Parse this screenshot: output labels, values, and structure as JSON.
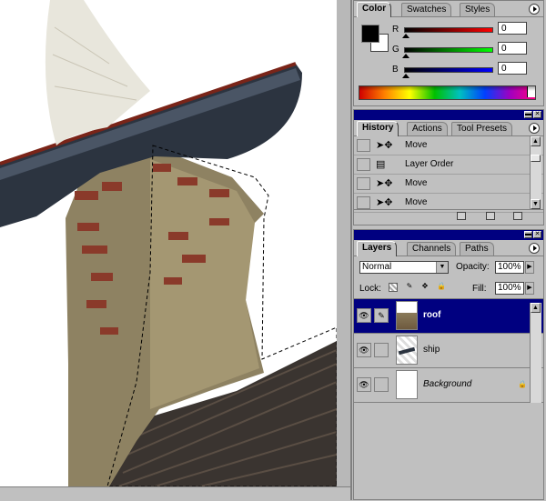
{
  "color_palette": {
    "tabs": [
      "Color",
      "Swatches",
      "Styles"
    ],
    "active_tab": "Color",
    "foreground_color": "#000000",
    "background_color": "#ffffff",
    "channels": [
      {
        "label": "R",
        "value": "0",
        "color": "#c00000"
      },
      {
        "label": "G",
        "value": "0",
        "color": "#00a000"
      },
      {
        "label": "B",
        "value": "0",
        "color": "#0000c0"
      }
    ]
  },
  "history_palette": {
    "tabs": [
      "History",
      "Actions",
      "Tool Presets"
    ],
    "active_tab": "History",
    "items": [
      {
        "label": "Move",
        "icon": "move-icon"
      },
      {
        "label": "Layer Order",
        "icon": "layer-order-icon"
      },
      {
        "label": "Move",
        "icon": "move-icon"
      },
      {
        "label": "Move",
        "icon": "move-icon"
      }
    ]
  },
  "layers_palette": {
    "tabs": [
      "Layers",
      "Channels",
      "Paths"
    ],
    "active_tab": "Layers",
    "blend_mode": "Normal",
    "opacity_label": "Opacity:",
    "opacity": "100%",
    "lock_label": "Lock:",
    "fill_label": "Fill:",
    "fill": "100%",
    "layers": [
      {
        "name": "roof",
        "selected": true,
        "visible": true,
        "icon": "brush-icon"
      },
      {
        "name": "ship",
        "selected": false,
        "visible": true
      },
      {
        "name": "Background",
        "selected": false,
        "visible": true,
        "locked": true
      }
    ]
  }
}
